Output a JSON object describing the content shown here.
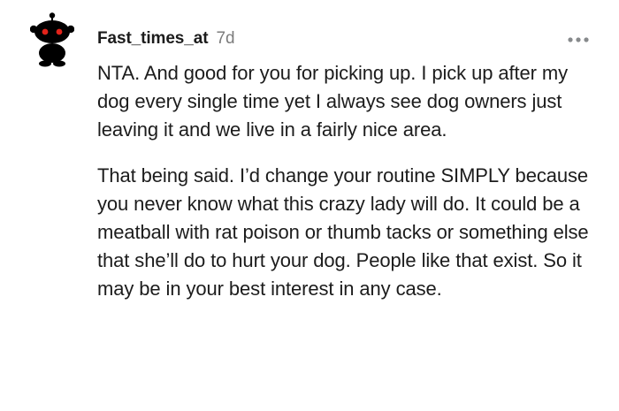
{
  "comment": {
    "username": "Fast_times_at",
    "age": "7d",
    "avatar_icon": "snoo-avatar-icon",
    "menu_icon": "more-options-icon",
    "paragraphs": [
      "NTA. And good for you for picking up. I pick up after my dog every single time yet I always see dog owners just leaving it and we live in a fairly nice area.",
      "That being said. I’d change your routine SIMPLY because you never know what this crazy lady will do. It could be a meatball with rat poison or thumb tacks or something else that she’ll do to hurt your dog. People like that exist. So it may be in your best interest in any case."
    ]
  },
  "colors": {
    "text": "#1c1c1c",
    "muted": "#7c7c7c",
    "avatar": "#000000",
    "avatar_eyes": "#e2231a"
  }
}
